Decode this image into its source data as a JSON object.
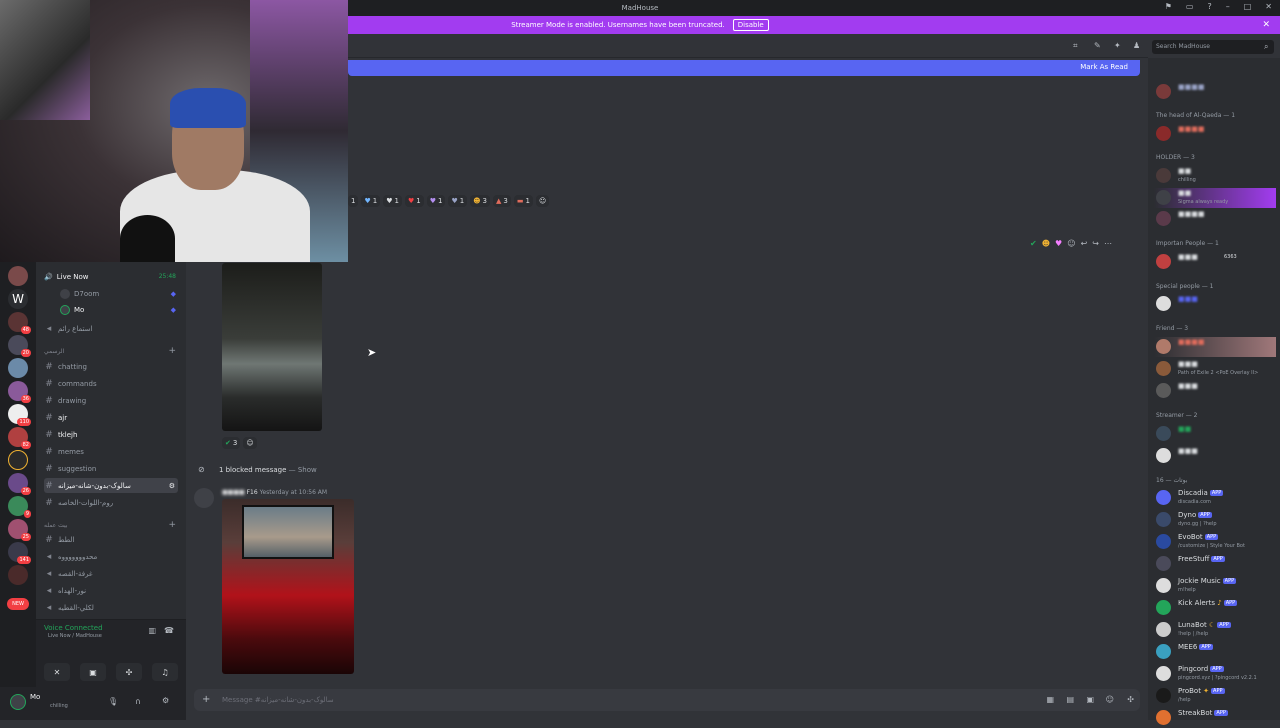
{
  "titlebar": {
    "title": "MadHouse"
  },
  "banner": {
    "text": "Streamer Mode is enabled. Usernames have been truncated.",
    "button": "Disable"
  },
  "newbar": {
    "button": "Mark As Read"
  },
  "search": {
    "placeholder": "Search MadHouse"
  },
  "colors": {
    "accent": "#5865f2",
    "streamer": "#a23cf0",
    "online": "#23a55a",
    "danger": "#f23f43"
  },
  "reactions_top": [
    "1",
    "1",
    "1",
    "1",
    "1",
    "1",
    "3",
    "3",
    "1"
  ],
  "sidebar": {
    "live_now": "Live Now",
    "live_time": "25:48",
    "voice_users": [
      "D7oom",
      "Mo"
    ],
    "channels": [
      {
        "label": "استماع رائم"
      },
      {
        "label": "chatting"
      },
      {
        "label": "commands"
      },
      {
        "label": "drawing"
      },
      {
        "label": "ajr"
      },
      {
        "label": "tklejh"
      },
      {
        "label": "memes"
      },
      {
        "label": "suggestion"
      },
      {
        "label": "سالوک-بدون-شانه-ميزانه"
      },
      {
        "label": "روم-اللوات-الخاصه"
      },
      {
        "label": "الطط"
      },
      {
        "label": "محدوووووووه"
      },
      {
        "label": "غرفة-القصه"
      },
      {
        "label": "نور-الهداه"
      },
      {
        "label": "لكلي-القطيه"
      }
    ],
    "category1": "الرسمي",
    "category2": "بيت عمله"
  },
  "voice": {
    "status": "Voice Connected",
    "sub": "Live Now / MadHouse"
  },
  "user": {
    "name": "Mo",
    "status": "chilling"
  },
  "messages": {
    "reaction_count": "3",
    "blocked": "1 blocked message",
    "show": "Show",
    "author_tag": "F16",
    "time": "Yesterday at 10:56 AM",
    "composer_placeholder": "Message #سالوک-بدون-شانه-ميزانه"
  },
  "members": {
    "categories": [
      "The head of Al-Qaeda — 1",
      "HOLDER — 3",
      "Importan People — 1",
      "Special people — 1",
      "Friend — 3",
      "Streamer — 2"
    ],
    "bots_header": "16 — بوتات",
    "bots": [
      {
        "name": "Discadia",
        "status": "discadia.com"
      },
      {
        "name": "Dyno",
        "status": "dyno.gg | ?help"
      },
      {
        "name": "EvoBot",
        "status": "/customize | Style Your Bot"
      },
      {
        "name": "FreeStuff",
        "status": ""
      },
      {
        "name": "Jockie Music",
        "status": "m!help"
      },
      {
        "name": "Kick Alerts",
        "status": ""
      },
      {
        "name": "LunaBot",
        "status": "!help | /help"
      },
      {
        "name": "MEE6",
        "status": ""
      },
      {
        "name": "Pingcord",
        "status": "pingcord.xyz | ?pingcord v2.2.1"
      },
      {
        "name": "ProBot",
        "status": "/help"
      },
      {
        "name": "StreakBot",
        "status": ""
      }
    ],
    "app_label": "APP",
    "status_lines": [
      "chilling",
      "Sigma always ready",
      "Path of Exile 2 <PoE Overlay II>",
      "6363"
    ]
  }
}
